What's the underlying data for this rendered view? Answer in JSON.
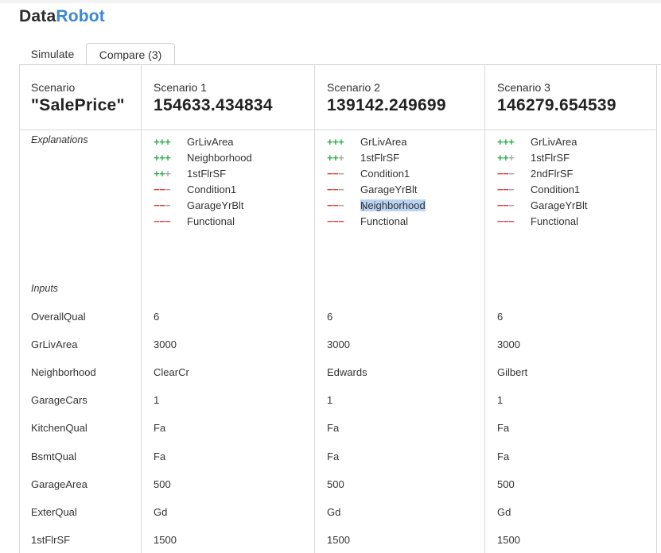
{
  "logo": {
    "part1": "Data",
    "part2": "Robot"
  },
  "tabs": [
    {
      "label": "Simulate"
    },
    {
      "label": "Compare (3)"
    }
  ],
  "header": {
    "label": "Scenario",
    "target": "\"SalePrice\""
  },
  "scenarios": [
    {
      "name": "Scenario 1",
      "value": "154633.434834"
    },
    {
      "name": "Scenario 2",
      "value": "139142.249699"
    },
    {
      "name": "Scenario 3",
      "value": "146279.654539"
    }
  ],
  "sections": {
    "explanations": "Explanations",
    "inputs": "Inputs"
  },
  "explanations": [
    [
      {
        "sign": "+++",
        "feature": "GrLivArea"
      },
      {
        "sign": "+++",
        "feature": "Neighborhood"
      },
      {
        "sign": "++ ",
        "feature": "1stFlrSF"
      },
      {
        "sign": "-- ",
        "feature": "Condition1"
      },
      {
        "sign": "-- ",
        "feature": "GarageYrBlt"
      },
      {
        "sign": "---",
        "feature": "Functional"
      }
    ],
    [
      {
        "sign": "+++",
        "feature": "GrLivArea"
      },
      {
        "sign": "++ ",
        "feature": "1stFlrSF"
      },
      {
        "sign": "-- ",
        "feature": "Condition1"
      },
      {
        "sign": "-- ",
        "feature": "GarageYrBlt"
      },
      {
        "sign": "-- ",
        "feature": "Neighborhood"
      },
      {
        "sign": "---",
        "feature": "Functional"
      }
    ],
    [
      {
        "sign": "+++",
        "feature": "GrLivArea"
      },
      {
        "sign": "++ ",
        "feature": "1stFlrSF"
      },
      {
        "sign": "-- ",
        "feature": "2ndFlrSF"
      },
      {
        "sign": "-- ",
        "feature": "Condition1"
      },
      {
        "sign": "-- ",
        "feature": "GarageYrBlt"
      },
      {
        "sign": "---",
        "feature": "Functional"
      }
    ]
  ],
  "inputs": [
    {
      "label": "OverallQual",
      "values": [
        "6",
        "6",
        "6"
      ]
    },
    {
      "label": "GrLivArea",
      "values": [
        "3000",
        "3000",
        "3000"
      ]
    },
    {
      "label": "Neighborhood",
      "values": [
        "ClearCr",
        "Edwards",
        "Gilbert"
      ]
    },
    {
      "label": "GarageCars",
      "values": [
        "1",
        "1",
        "1"
      ]
    },
    {
      "label": "KitchenQual",
      "values": [
        "Fa",
        "Fa",
        "Fa"
      ]
    },
    {
      "label": "BsmtQual",
      "values": [
        "Fa",
        "Fa",
        "Fa"
      ]
    },
    {
      "label": "GarageArea",
      "values": [
        "500",
        "500",
        "500"
      ]
    },
    {
      "label": "ExterQual",
      "values": [
        "Gd",
        "Gd",
        "Gd"
      ]
    },
    {
      "label": "1stFlrSF",
      "values": [
        "1500",
        "1500",
        "1500"
      ]
    }
  ],
  "colors": {
    "brand": "#3b86d6",
    "positive": "#2bb24c",
    "negative": "#e04444",
    "neutral": "#a8a8a8",
    "highlight": "#b8d4f2"
  }
}
